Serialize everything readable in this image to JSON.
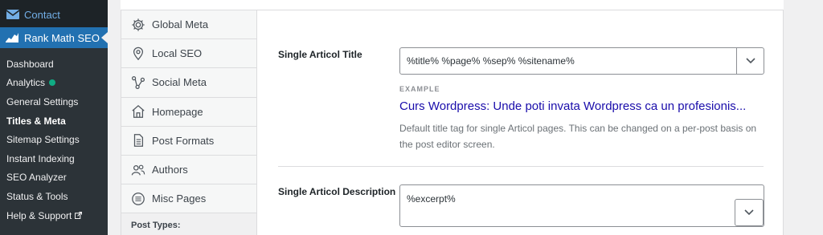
{
  "wp_menu": {
    "contact_label": "Contact",
    "plugin_label": "Rank Math SEO",
    "submenu": [
      {
        "label": "Dashboard"
      },
      {
        "label": "Analytics"
      },
      {
        "label": "General Settings"
      },
      {
        "label": "Titles & Meta"
      },
      {
        "label": "Sitemap Settings"
      },
      {
        "label": "Instant Indexing"
      },
      {
        "label": "SEO Analyzer"
      },
      {
        "label": "Status & Tools"
      },
      {
        "label": "Help & Support"
      }
    ]
  },
  "tabs": [
    {
      "label": "Global Meta",
      "icon": "gear-icon"
    },
    {
      "label": "Local SEO",
      "icon": "map-pin-icon"
    },
    {
      "label": "Social Meta",
      "icon": "share-nodes-icon"
    },
    {
      "label": "Homepage",
      "icon": "home-icon"
    },
    {
      "label": "Post Formats",
      "icon": "document-icon"
    },
    {
      "label": "Authors",
      "icon": "users-icon"
    },
    {
      "label": "Misc Pages",
      "icon": "list-circle-icon"
    }
  ],
  "tabs_section_header": "Post Types:",
  "fields": {
    "title": {
      "label": "Single Articol Title",
      "value": "%title% %page% %sep% %sitename%",
      "example_label": "EXAMPLE",
      "example_value": "Curs Wordpress: Unde poti invata Wordpress ca un profesionis...",
      "description": "Default title tag for single Articol pages. This can be changed on a per-post basis on the post editor screen."
    },
    "description": {
      "label": "Single Articol Description",
      "value": "%excerpt%"
    }
  },
  "colors": {
    "wp_sidebar": "#1d2327",
    "wp_active": "#2271b1",
    "link_blue": "#1a0dab",
    "analytics_dot": "#10ac84"
  }
}
